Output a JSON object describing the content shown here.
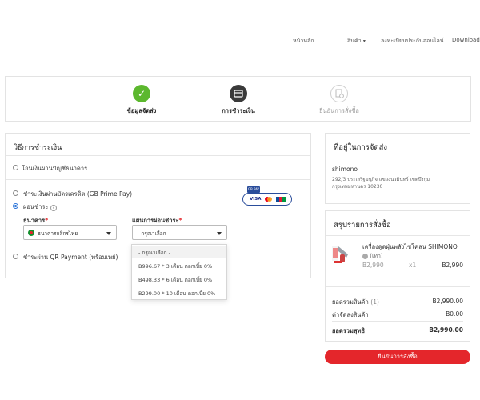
{
  "nav": {
    "items": [
      "หน้าหลัก",
      "สินค้า",
      "ลงทะเบียนประกันออนไลน์",
      "Download"
    ]
  },
  "stepper": {
    "steps": [
      {
        "label": "ข้อมูลจัดส่ง",
        "state": "done"
      },
      {
        "label": "การชำระเงิน",
        "state": "current"
      },
      {
        "label": "ยืนยันการสั่งซื้อ",
        "state": "pending"
      }
    ]
  },
  "payment": {
    "title": "วิธีการชำระเงิน",
    "option_bank_transfer": "โอนเงินผ่านบัญชีธนาคาร",
    "option_credit_card": "ชำระเงินผ่านบัตรเครดิต (GB Prime Pay)",
    "option_installment": "ผ่อนชำระ",
    "bank_label": "ธนาคาร",
    "plan_label": "แผนการผ่อนชำระ",
    "required_mark": "*",
    "bank_selected": "ธนาคารกสิกรไทย",
    "plan_selected": "- กรุณาเลือก -",
    "option_qr": "ชำระผ่าน QR Payment (พร้อมเพย์)",
    "selected_option": "installment",
    "card_badge": {
      "top": "GB PAY",
      "brands": [
        "VISA",
        "MC",
        "JCB"
      ]
    }
  },
  "plan_dropdown": {
    "options": [
      "- กรุณาเลือก -",
      "B996.67 * 3 เดือน ดอกเบี้ย 0%",
      "B498.33 * 6 เดือน ดอกเบี้ย 0%",
      "B299.00 * 10 เดือน ดอกเบี้ย 0%"
    ]
  },
  "shipping": {
    "title": "ที่อยู่ในการจัดส่ง",
    "name": "shimono",
    "address_line1": "292/3 ประเสริฐมนูกิจ แขวงนวมินทร์ เขตบึงกุ่ม",
    "address_line2": "กรุงเทพมหานคร 10230"
  },
  "order": {
    "title": "สรุปรายการสั่งซื้อ",
    "item_name_line1": "เครื่องดูดฝุ่นพลังไซโคลน SHIMONO",
    "item_color": "(เทา)",
    "item_price": "B2,990",
    "item_qty": "x1",
    "item_total": "B2,990",
    "subtotal_label": "ยอดรวมสินค้า",
    "subtotal_count": "(1)",
    "subtotal_value": "B2,990.00",
    "shipping_label": "ค่าจัดส่งสินค้า",
    "shipping_value": "B0.00",
    "grand_label": "ยอดรวมสุทธิ",
    "grand_value": "B2,990.00"
  },
  "confirm_button": "ยืนยันการสั่งซื้อ",
  "colors": {
    "accent_red": "#e4262b",
    "done_green": "#5cb82e",
    "current_dark": "#3a3a3a",
    "radio_blue": "#2b74d8"
  }
}
